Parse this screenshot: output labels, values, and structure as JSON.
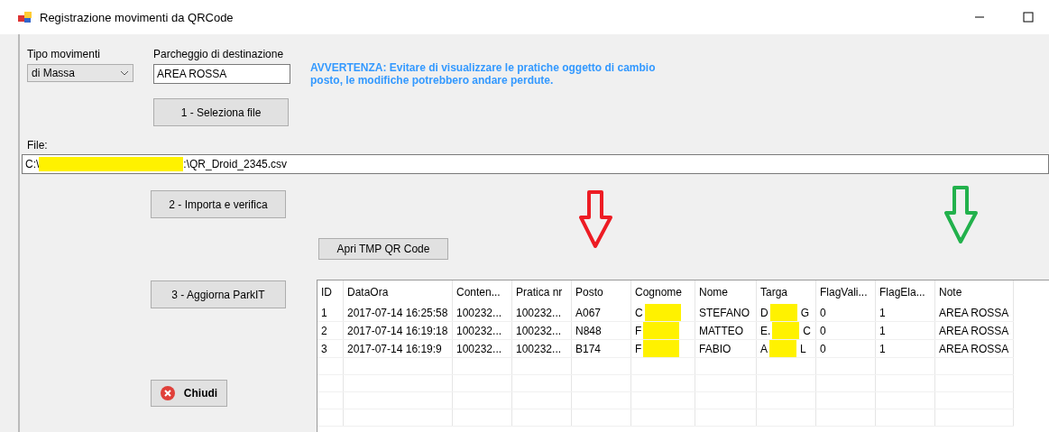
{
  "window": {
    "title": "Registrazione movimenti da QRCode"
  },
  "tipo_movimenti": {
    "label": "Tipo movimenti",
    "value": "di Massa"
  },
  "parcheggio": {
    "label": "Parcheggio di destinazione",
    "value": "AREA ROSSA"
  },
  "warning": "AVVERTENZA: Evitare di visualizzare le pratiche oggetto di cambio posto, le modifiche potrebbero andare perdute.",
  "buttons": {
    "select": "1 - Seleziona file",
    "import": "2 - Importa e verifica",
    "open_tmp": "Apri TMP QR Code",
    "update": "3 - Aggiorna ParkIT",
    "close": "Chiudi"
  },
  "file": {
    "label": "File:",
    "value_start": "C:\\",
    "value_end": ":\\QR_Droid_2345.csv"
  },
  "table": {
    "columns": [
      "ID",
      "DataOra",
      "Conten...",
      "Pratica nr",
      "Posto",
      "Cognome",
      "Nome",
      "Targa",
      "FlagVali...",
      "FlagEla...",
      "Note"
    ],
    "rows": [
      {
        "cells": [
          "1",
          "2017-07-14 16:25:58",
          "100232...",
          "100232...",
          "A067",
          "C",
          "STEFANO",
          "D",
          "0",
          "1",
          "AREA ROSSA"
        ],
        "targa_end": "G"
      },
      {
        "cells": [
          "2",
          "2017-07-14 16:19:18",
          "100232...",
          "100232...",
          "N848",
          "F",
          "MATTEO",
          "E.",
          "0",
          "1",
          "AREA ROSSA"
        ],
        "targa_end": "C"
      },
      {
        "cells": [
          "3",
          "2017-07-14 16:19:9",
          "100232...",
          "100232...",
          "B174",
          "F",
          "FABIO",
          "A",
          "0",
          "1",
          "AREA ROSSA"
        ],
        "targa_end": "L"
      }
    ]
  },
  "annotations": [
    {
      "kind": "arrow",
      "color": "#ed1c24"
    },
    {
      "kind": "arrow",
      "color": "#22b14c"
    }
  ]
}
